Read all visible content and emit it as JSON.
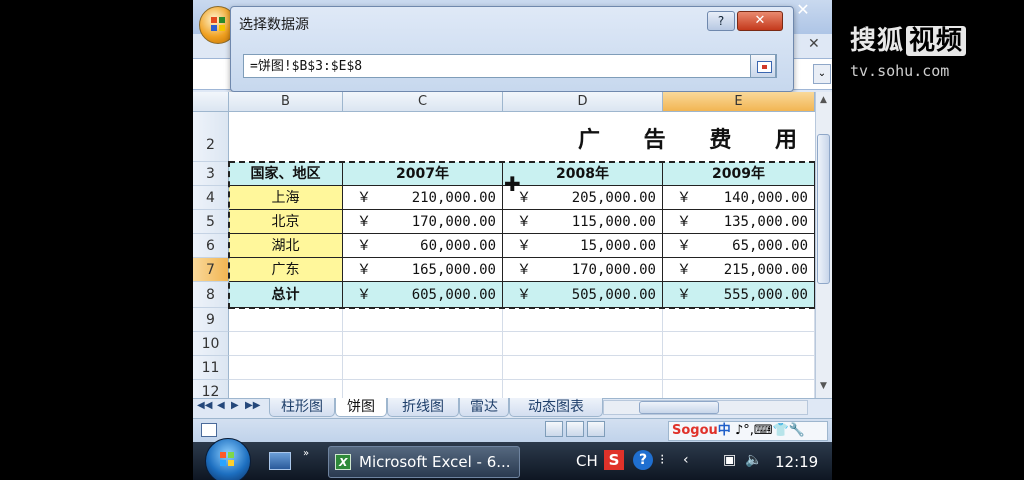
{
  "watermark": {
    "brand_a": "搜狐",
    "brand_b": "视频",
    "url": "tv.sohu.com"
  },
  "dialog": {
    "title": "选择数据源",
    "help": "?",
    "close": "✕",
    "range_value": "=饼图!$B$3:$E$8"
  },
  "columns": [
    "B",
    "C",
    "D",
    "E"
  ],
  "selected_column": "E",
  "rows": [
    "2",
    "3",
    "4",
    "5",
    "6",
    "7",
    "8",
    "9",
    "10",
    "11",
    "12"
  ],
  "selected_row": "7",
  "sheet": {
    "title": "广 告 费 用",
    "header": {
      "region": "国家、地区",
      "y2007": "2007年",
      "y2008": "2008年",
      "y2009": "2009年"
    },
    "currency": "￥",
    "data": [
      {
        "region": "上海",
        "v2007": "210,000.00",
        "v2008": "205,000.00",
        "v2009": "140,000.00"
      },
      {
        "region": "北京",
        "v2007": "170,000.00",
        "v2008": "115,000.00",
        "v2009": "135,000.00"
      },
      {
        "region": "湖北",
        "v2007": "60,000.00",
        "v2008": "15,000.00",
        "v2009": "65,000.00"
      },
      {
        "region": "广东",
        "v2007": "165,000.00",
        "v2008": "170,000.00",
        "v2009": "215,000.00"
      }
    ],
    "total": {
      "region": "总计",
      "v2007": "605,000.00",
      "v2008": "505,000.00",
      "v2009": "555,000.00"
    }
  },
  "tabs": [
    {
      "label": "柱形图",
      "active": false
    },
    {
      "label": "饼图",
      "active": true
    },
    {
      "label": "折线图",
      "active": false
    },
    {
      "label": "雷达",
      "active": false
    },
    {
      "label": "动态图表",
      "active": false
    }
  ],
  "ime": {
    "brand": "Sogou",
    "mode": "中"
  },
  "taskbar": {
    "task_label": "Microsoft Excel - 6...",
    "lang": "CH",
    "sogou_tray": "S",
    "help_tray": "?",
    "clock": "12:19"
  }
}
